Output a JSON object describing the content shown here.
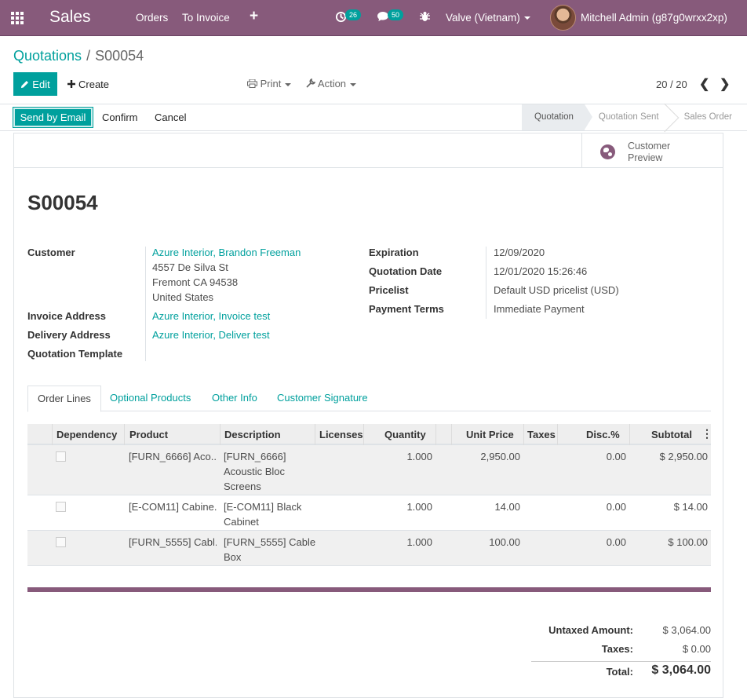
{
  "topbar": {
    "app_name": "Sales",
    "menu": [
      "Orders",
      "To Invoice"
    ],
    "plus": "+",
    "activity_count": "26",
    "message_count": "50",
    "company": "Valve (Vietnam)",
    "user": "Mitchell Admin (g87g0wrxx2xp)",
    "accent_color": "#875a7b",
    "icons": [
      "apps-grid-icon",
      "plus-icon",
      "activity-clock-icon",
      "chat-icon",
      "bug-icon",
      "avatar"
    ]
  },
  "breadcrumb": {
    "parent": "Quotations",
    "separator": "/",
    "current": "S00054"
  },
  "buttons": {
    "edit": "Edit",
    "create": "Create",
    "print": "Print",
    "action": "Action"
  },
  "pager": {
    "value": "20 / 20"
  },
  "statusbar": {
    "send_email": "Send by Email",
    "confirm": "Confirm",
    "cancel": "Cancel",
    "stages": [
      "Quotation",
      "Quotation Sent",
      "Sales Order"
    ],
    "active_stage": "Quotation"
  },
  "smart_button": {
    "line1": "Customer",
    "line2": "Preview"
  },
  "record": {
    "name": "S00054",
    "customer_label": "Customer",
    "customer": "Azure Interior, Brandon Freeman",
    "address1": "4557 De Silva St",
    "address2": "Fremont CA 94538",
    "address3": "United States",
    "invoice_label": "Invoice Address",
    "invoice_address": "Azure Interior, Invoice test",
    "delivery_label": "Delivery Address",
    "delivery_address": "Azure Interior, Deliver test",
    "template_label": "Quotation Template",
    "expiration_label": "Expiration",
    "expiration": "12/09/2020",
    "qdate_label": "Quotation Date",
    "qdate": "12/01/2020 15:26:46",
    "pricelist_label": "Pricelist",
    "pricelist": "Default USD pricelist (USD)",
    "terms_label": "Payment Terms",
    "terms": "Immediate Payment"
  },
  "tabs": [
    "Order Lines",
    "Optional Products",
    "Other Info",
    "Customer Signature"
  ],
  "columns": [
    "Dependency",
    "Product",
    "Description",
    "Licenses",
    "Quantity",
    "Unit Price",
    "Taxes",
    "Disc.%",
    "Subtotal"
  ],
  "lines": [
    {
      "product": "[FURN_6666] Aco...",
      "desc1": "[FURN_6666]",
      "desc2": "Acoustic Bloc",
      "desc3": "Screens",
      "qty": "1.000",
      "price": "2,950.00",
      "taxes": "",
      "disc": "0.00",
      "subtotal": "$ 2,950.00"
    },
    {
      "product": "[E-COM11] Cabine...",
      "desc1": "[E-COM11] Black",
      "desc2": "Cabinet",
      "desc3": "",
      "qty": "1.000",
      "price": "14.00",
      "taxes": "",
      "disc": "0.00",
      "subtotal": "$ 14.00"
    },
    {
      "product": "[FURN_5555] Cabl...",
      "desc1": "[FURN_5555] Cable",
      "desc2": "Box",
      "desc3": "",
      "qty": "1.000",
      "price": "100.00",
      "taxes": "",
      "disc": "0.00",
      "subtotal": "$ 100.00"
    }
  ],
  "totals": {
    "untaxed_label": "Untaxed Amount:",
    "untaxed": "$ 3,064.00",
    "taxes_label": "Taxes:",
    "taxes": "$ 0.00",
    "total_label": "Total:",
    "total": "$ 3,064.00"
  }
}
